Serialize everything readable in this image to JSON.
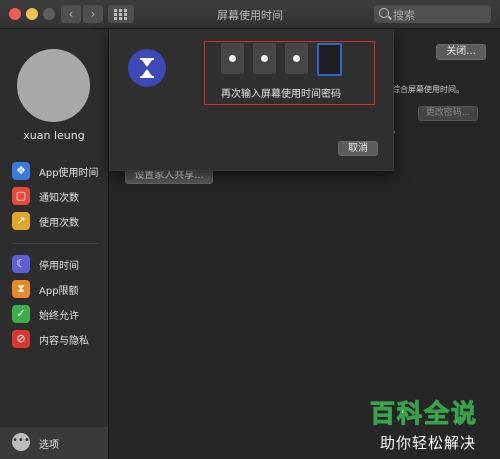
{
  "window": {
    "title": "屏幕使用时间"
  },
  "search": {
    "placeholder": "搜索"
  },
  "sidebar": {
    "username": "xuan leung",
    "items": [
      {
        "label": "App使用时间",
        "icon": "layers-icon",
        "color": "#3a7bdc"
      },
      {
        "label": "通知次数",
        "icon": "bell-badge-icon",
        "color": "#e54a3c"
      },
      {
        "label": "使用次数",
        "icon": "pickup-icon",
        "color": "#e0a72c"
      },
      {
        "label": "停用时间",
        "icon": "moon-icon",
        "color": "#5c5fd6"
      },
      {
        "label": "App限额",
        "icon": "hourglass-icon",
        "color": "#e8892a"
      },
      {
        "label": "始终允许",
        "icon": "checkmark-icon",
        "color": "#3fae48"
      },
      {
        "label": "内容与隐私",
        "icon": "no-entry-icon",
        "color": "#d9382e"
      }
    ],
    "options_label": "选项"
  },
  "main": {
    "turn_off_button": "关闭...",
    "description_tail": "综合屏幕使用时间。",
    "change_passcode_button": "更改密码...",
    "period_fragment": "。",
    "family_sharing_button": "设置家人共享..."
  },
  "sheet": {
    "prompt": "再次输入屏幕使用时间密码",
    "digits_entered": 3,
    "digits_total": 4,
    "cancel_button": "取消"
  },
  "watermark": {
    "line1": "百科全说",
    "line2": "助你轻松解决"
  }
}
